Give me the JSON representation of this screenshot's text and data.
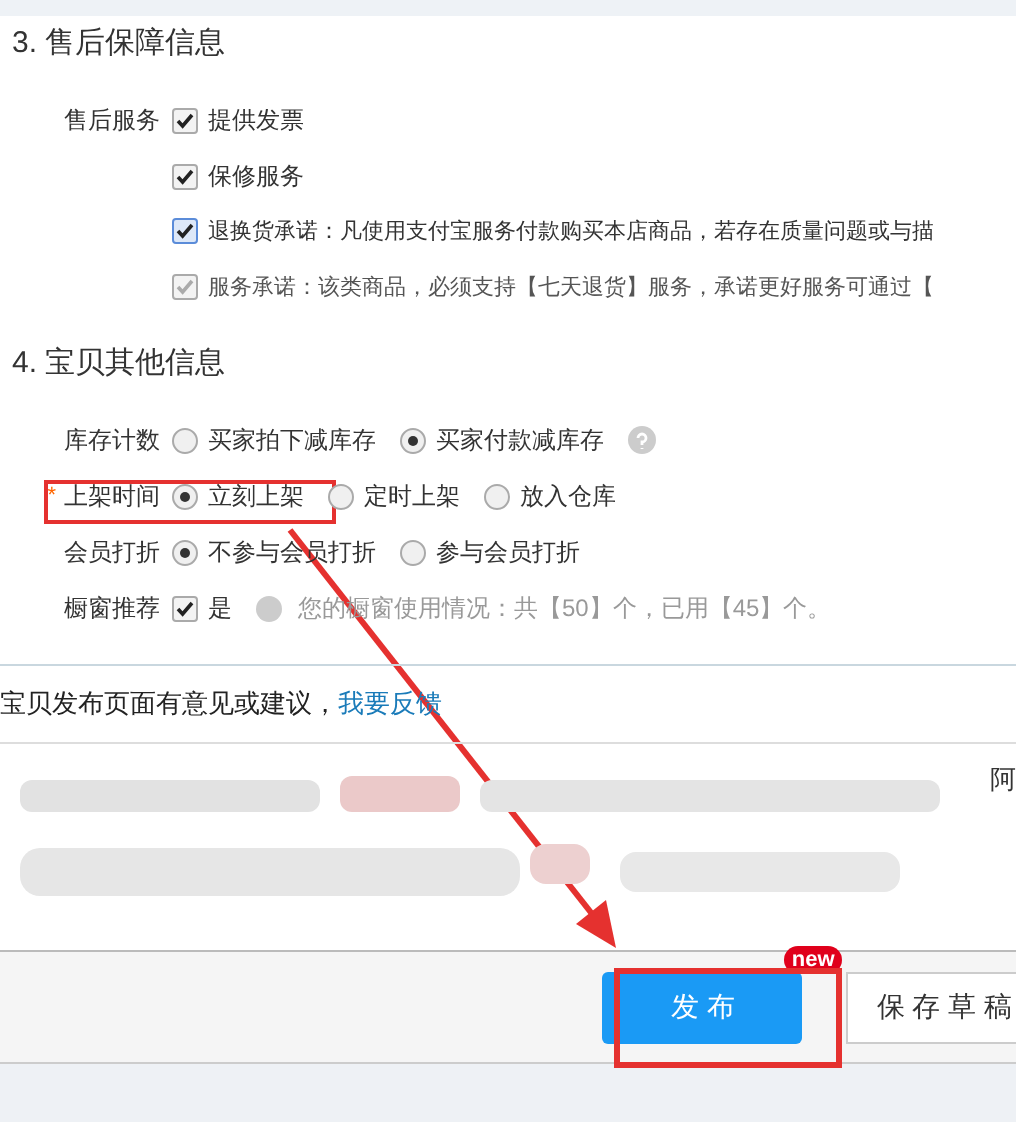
{
  "sections": [
    {
      "title": "3. 售后保障信息",
      "rows": [
        {
          "label": "售后服务",
          "options": [
            {
              "kind": "checkbox",
              "text": "提供发票",
              "checked": true,
              "disabled": false
            }
          ]
        },
        {
          "options": [
            {
              "kind": "checkbox",
              "text": "保修服务",
              "checked": true,
              "disabled": false
            }
          ]
        },
        {
          "options": [
            {
              "kind": "checkbox",
              "text": "退换货承诺：凡使用支付宝服务付款购买本店商品，若存在质量问题或与描",
              "checked": true,
              "disabled": false,
              "focused": true
            }
          ]
        },
        {
          "options": [
            {
              "kind": "checkbox",
              "text": "服务承诺：该类商品，必须支持【七天退货】服务，承诺更好服务可通过【",
              "checked": true,
              "disabled": true
            }
          ]
        }
      ]
    },
    {
      "title": "4. 宝贝其他信息",
      "rows": [
        {
          "label": "库存计数",
          "options": [
            {
              "kind": "radio",
              "text": "买家拍下减库存",
              "selected": false
            },
            {
              "kind": "radio",
              "text": "买家付款减库存",
              "selected": true
            },
            {
              "kind": "help"
            }
          ]
        },
        {
          "label": "上架时间",
          "required_mark": "*",
          "options": [
            {
              "kind": "radio",
              "text": "立刻上架",
              "selected": true
            },
            {
              "kind": "radio",
              "text": "定时上架",
              "selected": false
            },
            {
              "kind": "radio",
              "text": "放入仓库",
              "selected": false
            }
          ]
        },
        {
          "label": "会员打折",
          "options": [
            {
              "kind": "radio",
              "text": "不参与会员打折",
              "selected": true
            },
            {
              "kind": "radio",
              "text": "参与会员打折",
              "selected": false
            }
          ]
        },
        {
          "label": "橱窗推荐",
          "options": [
            {
              "kind": "checkbox",
              "text": "是",
              "checked": true,
              "disabled": false
            },
            {
              "kind": "info"
            },
            {
              "kind": "note",
              "text": "您的橱窗使用情况：共【50】个，已用【45】个。"
            }
          ]
        }
      ]
    }
  ],
  "feedback": {
    "text": "宝贝发布页面有意见或建议，",
    "link": "我要反馈"
  },
  "blurred_row_end": "阿",
  "footer": {
    "publish": "发 布",
    "badge": "new",
    "save_draft": "保 存 草 稿"
  }
}
